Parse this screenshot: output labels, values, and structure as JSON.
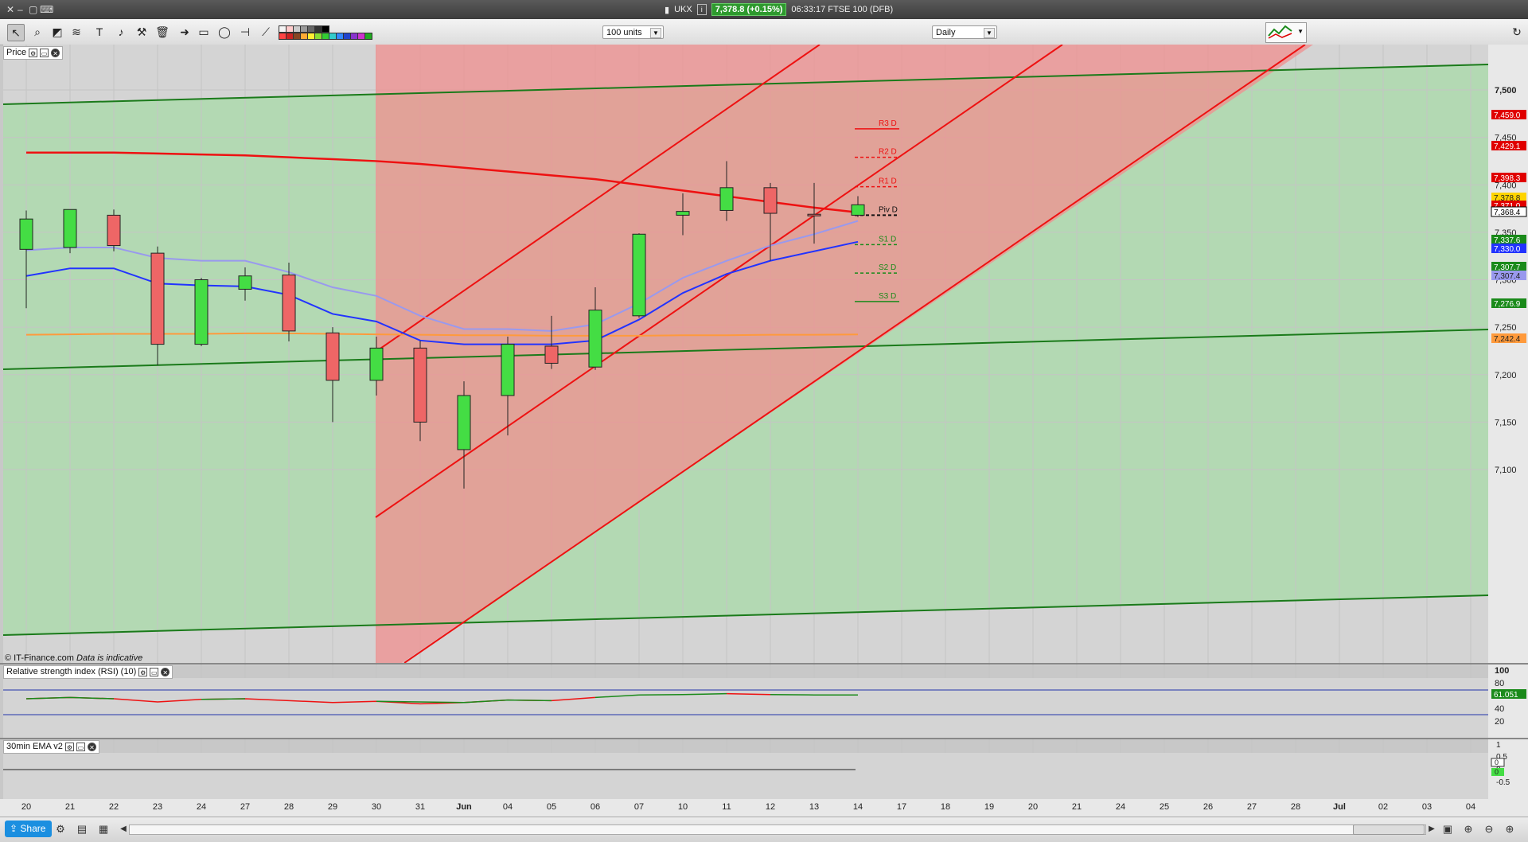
{
  "window": {
    "instrument": "UKX",
    "quote": "7,378.8 (+0.15%)",
    "status": "06:33:17 FTSE 100 (DFB)"
  },
  "toolbar": {
    "units_select": "100 units",
    "interval_select": "Daily"
  },
  "price_panel": {
    "label": "Price",
    "attribution": "© IT-Finance.com",
    "disclaimer": "Data is indicative",
    "axis_labels": [
      "7,500",
      "7,450",
      "7,400",
      "7,350",
      "7,300",
      "7,250",
      "7,200",
      "7,150",
      "7,100"
    ],
    "pivot_labels": [
      "R3 D",
      "R2 D",
      "R1 D",
      "Piv D",
      "S1 D",
      "S2 D",
      "S3 D"
    ],
    "badges": [
      {
        "text": "7,459.0",
        "color": "#e00000"
      },
      {
        "text": "7,429.1",
        "color": "#e00000"
      },
      {
        "text": "7,398.3",
        "color": "#e00000"
      },
      {
        "text": "7,378.8",
        "color": "#ffd400"
      },
      {
        "text": "7,371.0",
        "color": "#e00000"
      },
      {
        "text": "7,368.4",
        "color": "#000000"
      },
      {
        "text": "7,337.6",
        "color": "#1a8a1a"
      },
      {
        "text": "7,330.0",
        "color": "#2233ff"
      },
      {
        "text": "7,307.7",
        "color": "#1a8a1a"
      },
      {
        "text": "7,307.4",
        "color": "#9999ee"
      },
      {
        "text": "7,276.9",
        "color": "#1a8a1a"
      },
      {
        "text": "7,242.4",
        "color": "#ff9a3c"
      }
    ]
  },
  "rsi_panel": {
    "label": "Relative strength index (RSI) (10)",
    "axis_labels": [
      "100",
      "80",
      "60",
      "40",
      "20"
    ],
    "value_badge": "61.051"
  },
  "ema_panel": {
    "label": "30min EMA v2",
    "axis_labels": [
      "1",
      "0.5",
      "0",
      "-0.5"
    ],
    "value_badges": [
      "0",
      "0"
    ]
  },
  "x_axis": [
    "20",
    "21",
    "22",
    "23",
    "24",
    "27",
    "28",
    "29",
    "30",
    "31",
    "Jun",
    "04",
    "05",
    "06",
    "07",
    "10",
    "11",
    "12",
    "13",
    "14",
    "17",
    "18",
    "19",
    "20",
    "21",
    "24",
    "25",
    "26",
    "27",
    "28",
    "Jul",
    "02",
    "03",
    "04"
  ],
  "bottombar": {
    "share_label": "Share"
  },
  "chart_data": {
    "type": "candlestick",
    "ylim": [
      7060,
      7540
    ],
    "candles": [
      {
        "o": 7332,
        "h": 7373,
        "l": 7270,
        "c": 7364
      },
      {
        "o": 7334,
        "h": 7372,
        "l": 7328,
        "c": 7374
      },
      {
        "o": 7368,
        "h": 7374,
        "l": 7330,
        "c": 7336
      },
      {
        "o": 7328,
        "h": 7335,
        "l": 7210,
        "c": 7232
      },
      {
        "o": 7232,
        "h": 7302,
        "l": 7230,
        "c": 7300
      },
      {
        "o": 7290,
        "h": 7313,
        "l": 7278,
        "c": 7304
      },
      {
        "o": 7305,
        "h": 7318,
        "l": 7235,
        "c": 7246
      },
      {
        "o": 7244,
        "h": 7250,
        "l": 7150,
        "c": 7194
      },
      {
        "o": 7194,
        "h": 7240,
        "l": 7178,
        "c": 7228
      },
      {
        "o": 7228,
        "h": 7236,
        "l": 7130,
        "c": 7150
      },
      {
        "o": 7121,
        "h": 7193,
        "l": 7080,
        "c": 7178
      },
      {
        "o": 7178,
        "h": 7240,
        "l": 7136,
        "c": 7232
      },
      {
        "o": 7230,
        "h": 7262,
        "l": 7206,
        "c": 7212
      },
      {
        "o": 7208,
        "h": 7292,
        "l": 7205,
        "c": 7268
      },
      {
        "o": 7262,
        "h": 7349,
        "l": 7260,
        "c": 7348
      },
      {
        "o": 7368,
        "h": 7391,
        "l": 7347,
        "c": 7372
      },
      {
        "o": 7373,
        "h": 7425,
        "l": 7362,
        "c": 7397
      },
      {
        "o": 7397,
        "h": 7402,
        "l": 7320,
        "c": 7370
      },
      {
        "o": 7369,
        "h": 7402,
        "l": 7338,
        "c": 7368
      },
      {
        "o": 7368,
        "h": 7388,
        "l": 7366,
        "c": 7379
      }
    ],
    "pivots": {
      "R3": 7459,
      "R2": 7429,
      "R1": 7398,
      "P": 7368,
      "S1": 7337,
      "S2": 7307,
      "S3": 7277
    }
  }
}
